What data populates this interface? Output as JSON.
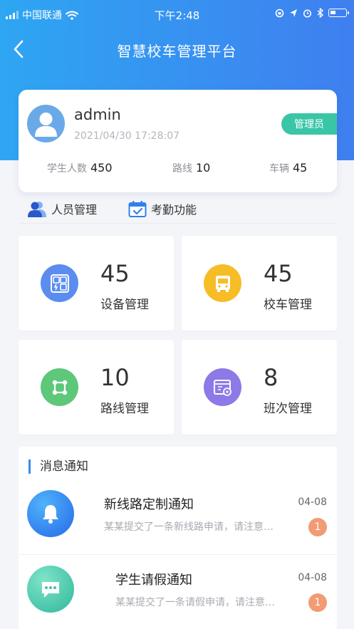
{
  "status_bar": {
    "carrier": "中国联通",
    "time": "下午2:48",
    "signal_icon": "signal-icon",
    "wifi_icon": "wifi-icon",
    "battery_icon": "battery-icon"
  },
  "nav": {
    "back_icon": "chevron-left-icon",
    "title": "智慧校车管理平台"
  },
  "user": {
    "name": "admin",
    "login_time": "2021/04/30 17:28:07",
    "role": "管理员",
    "avatar_icon": "user-avatar-icon"
  },
  "stats": [
    {
      "label": "学生人数",
      "value": "450"
    },
    {
      "label": "路线",
      "value": "10"
    },
    {
      "label": "车辆",
      "value": "45"
    }
  ],
  "quick_links": [
    {
      "label": "人员管理",
      "icon": "people-icon"
    },
    {
      "label": "考勤功能",
      "icon": "calendar-check-icon"
    }
  ],
  "tiles": [
    {
      "count": "45",
      "label": "设备管理",
      "icon": "device-icon",
      "color": "#5b8def"
    },
    {
      "count": "45",
      "label": "校车管理",
      "icon": "bus-icon",
      "color": "#f6bd27"
    },
    {
      "count": "10",
      "label": "路线管理",
      "icon": "route-icon",
      "color": "#5dc77a"
    },
    {
      "count": "8",
      "label": "班次管理",
      "icon": "schedule-icon",
      "color": "#8e79e6"
    }
  ],
  "notices": {
    "title": "消息通知",
    "items": [
      {
        "title": "新线路定制通知",
        "date": "04-08",
        "summary": "某某提交了一条新线路申请，请注意…",
        "badge": "1",
        "icon": "bell-icon"
      },
      {
        "title": "学生请假通知",
        "date": "04-08",
        "summary": "某某提交了一条请假申请，请注意…",
        "badge": "1",
        "icon": "chat-icon"
      }
    ]
  },
  "colors": {
    "header_start": "#2ea6f2",
    "header_end": "#3f7ff0",
    "role_badge": "#3bc5a7",
    "unread_badge": "#f29b74",
    "accent": "#3b8af0"
  }
}
